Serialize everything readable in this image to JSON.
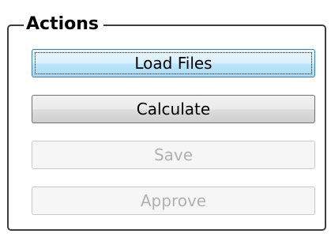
{
  "group": {
    "title": "Actions"
  },
  "buttons": {
    "load_files": "Load Files",
    "calculate": "Calculate",
    "save": "Save",
    "approve": "Approve"
  },
  "states": {
    "load_files": "focused",
    "calculate": "enabled",
    "save": "disabled",
    "approve": "disabled"
  }
}
